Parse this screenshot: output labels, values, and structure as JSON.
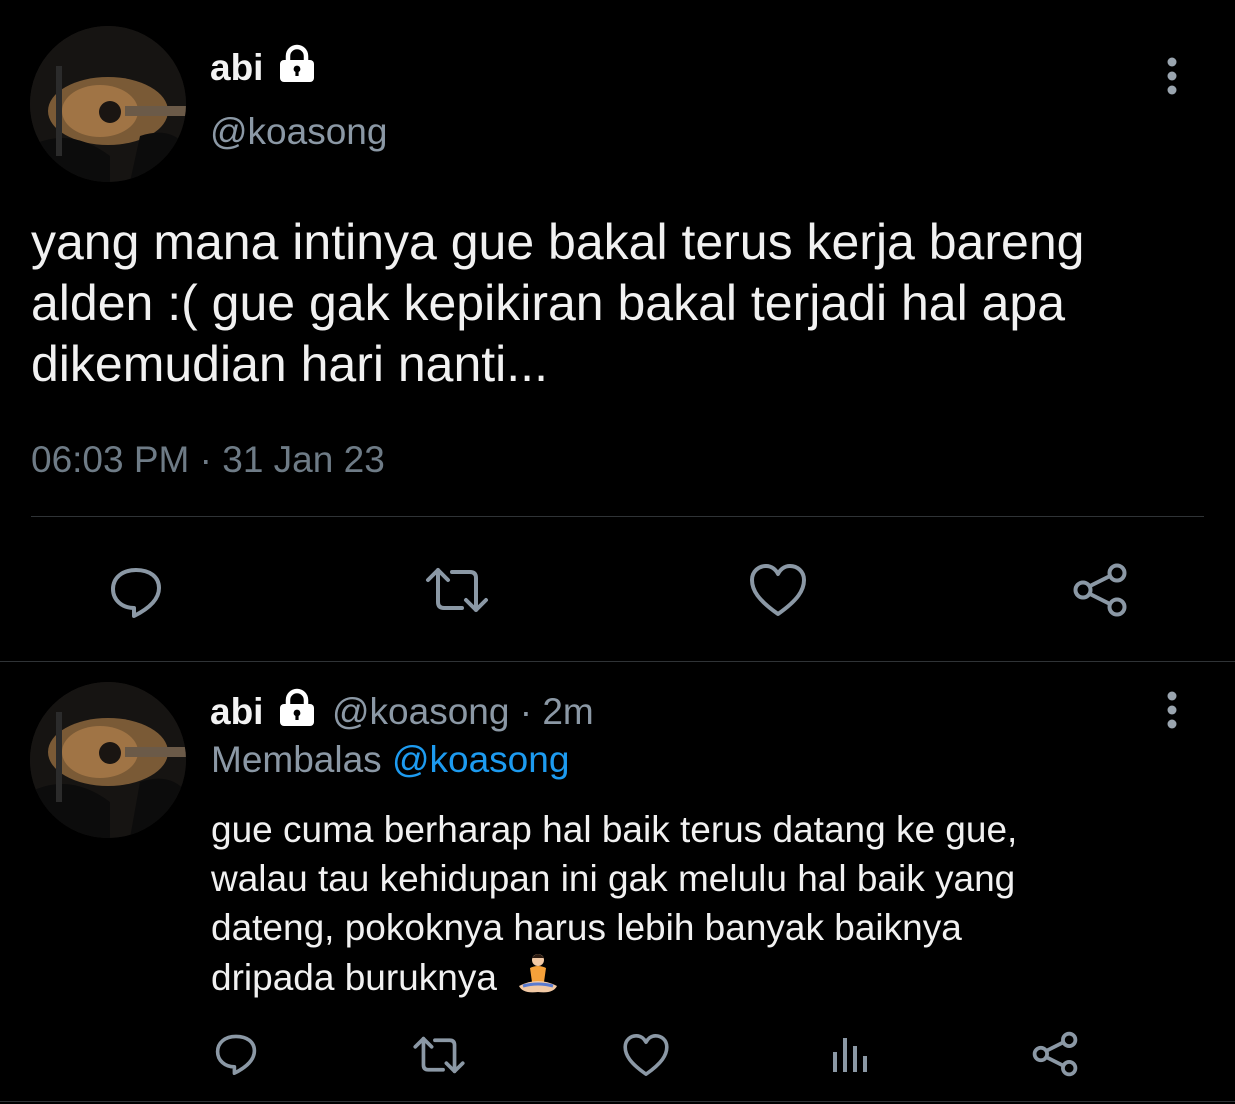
{
  "main_tweet": {
    "display_name": "abi",
    "handle": "@koasong",
    "text": "yang mana intinya gue bakal terus kerja bareng alden :( gue gak kepikiran bakal terjadi hal apa dikemudian hari nanti...",
    "timestamp": "06:03 PM · 31 Jan 23",
    "avatar": "guitar-player-avatar",
    "actions": [
      "reply-icon",
      "retweet-icon",
      "like-icon",
      "share-icon"
    ]
  },
  "reply_tweet": {
    "display_name": "abi",
    "handle": "@koasong",
    "separator": "·",
    "time": "2m",
    "replying_label": "Membalas",
    "replying_to": "@koasong",
    "text_lines": [
      "gue cuma berharap hal baik terus datang ke gue,",
      "walau tau kehidupan ini gak melulu hal baik yang",
      "dateng, pokoknya harus lebih banyak baiknya",
      "dripada buruknya"
    ],
    "emoji": "🧘‍♀️",
    "actions": [
      "reply-icon",
      "retweet-icon",
      "like-icon",
      "analytics-icon",
      "share-icon"
    ]
  },
  "colors": {
    "background": "#000000",
    "text": "#f1f1f1",
    "secondary": "#8b98a5",
    "link": "#1d9bf0",
    "divider": "#2f3336"
  }
}
